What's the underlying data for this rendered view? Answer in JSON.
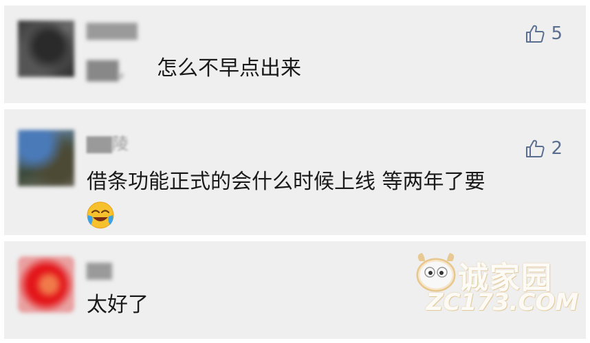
{
  "comments": [
    {
      "username": "▇▇▇▇",
      "blurred_prefix": "▇▇,",
      "text": "怎么不早点出来",
      "likes": "5",
      "icon": "thumbs-up-icon"
    },
    {
      "username": "▇▇陵",
      "text": "借条功能正式的会什么时候上线 等两年了要",
      "emoji": "crying-laughing-emoji",
      "likes": "2",
      "icon": "thumbs-up-icon"
    },
    {
      "username": "▇▇",
      "text": "太好了"
    }
  ],
  "watermark": {
    "cn": "诚家园",
    "en": "ZC173.COM"
  },
  "colors": {
    "card_bg": "#efefef",
    "like_color": "#5a6f8f",
    "text_color": "#1a1a1a"
  }
}
